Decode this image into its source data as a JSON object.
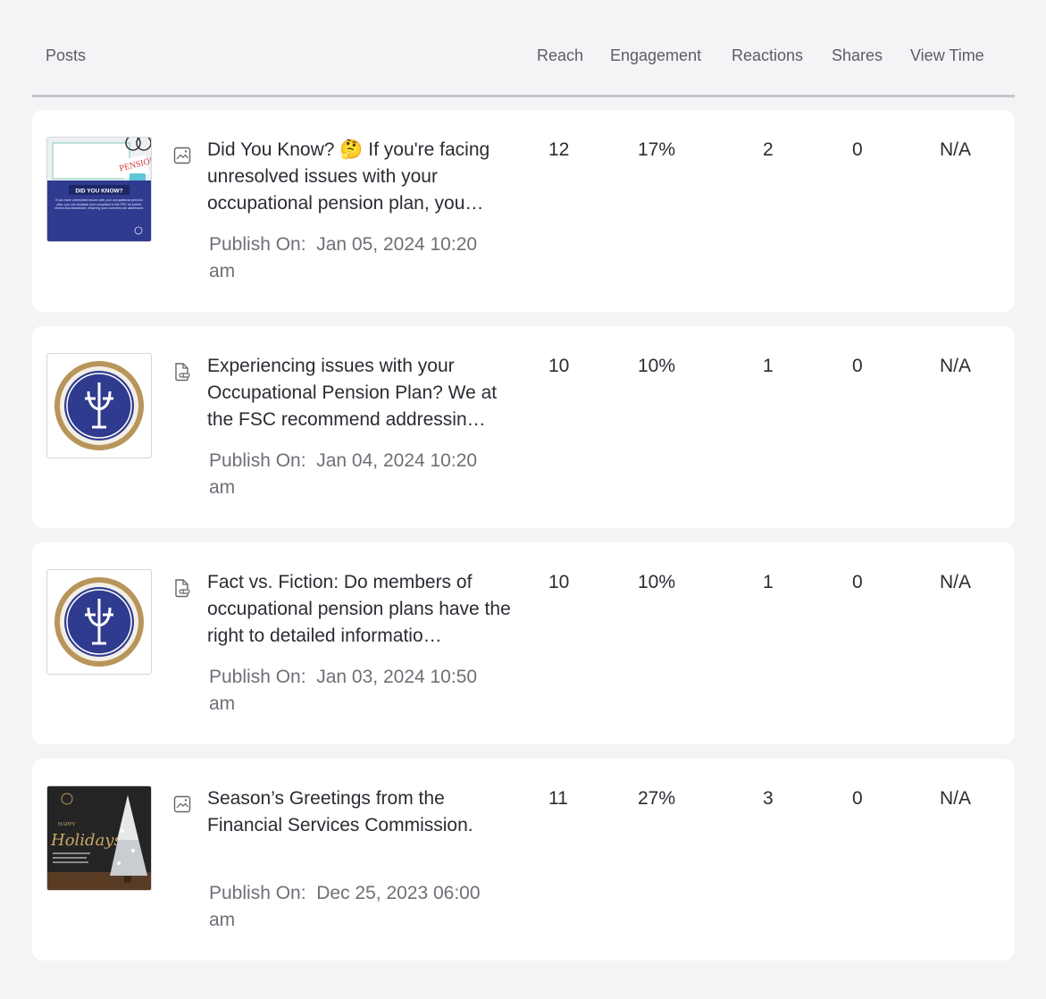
{
  "header": {
    "posts": "Posts",
    "reach": "Reach",
    "engagement": "Engagement",
    "reactions": "Reactions",
    "shares": "Shares",
    "view_time": "View Time"
  },
  "publish_label": "Publish On:",
  "colors": {
    "navy": "#2f3b8f",
    "gold": "#b8955a",
    "card_bg": "#ffffff",
    "page_bg": "#f4f4f6"
  },
  "posts": [
    {
      "thumb": "did-you-know-pension",
      "type_icon": "image-icon",
      "title": "Did You Know? 🤔 If you're facing unresolved issues with your occupational pension plan, you…",
      "publish": "Jan 05, 2024 10:20 am",
      "reach": "12",
      "engagement": "17%",
      "reactions": "2",
      "shares": "0",
      "view_time": "N/A",
      "thumb_text": {
        "stamp": "PENSION",
        "banner": "DID YOU KNOW?",
        "body": "If you have unresolved issues with your occupational pension plan, you can escalate your complaint to the FSC for further review and assistance, ensuring your concerns are addressed."
      }
    },
    {
      "thumb": "fsc-seal",
      "type_icon": "link-doc-icon",
      "title": "Experiencing issues with your Occupational Pension Plan? We at the FSC recommend addressin…",
      "publish": "Jan 04, 2024 10:20 am",
      "reach": "10",
      "engagement": "10%",
      "reactions": "1",
      "shares": "0",
      "view_time": "N/A"
    },
    {
      "thumb": "fsc-seal",
      "type_icon": "link-doc-icon",
      "title": "Fact vs. Fiction: Do members of occupational pension plans have the right to detailed informatio…",
      "publish": "Jan 03, 2024 10:50 am",
      "reach": "10",
      "engagement": "10%",
      "reactions": "1",
      "shares": "0",
      "view_time": "N/A"
    },
    {
      "thumb": "happy-holidays",
      "type_icon": "image-icon",
      "title": "Season’s Greetings from the Financial Services Commission.",
      "publish": "Dec 25, 2023 06:00 am",
      "reach": "11",
      "engagement": "27%",
      "reactions": "3",
      "shares": "0",
      "view_time": "N/A",
      "thumb_text": {
        "small": "HAPPY",
        "script": "Holidays!"
      }
    }
  ]
}
